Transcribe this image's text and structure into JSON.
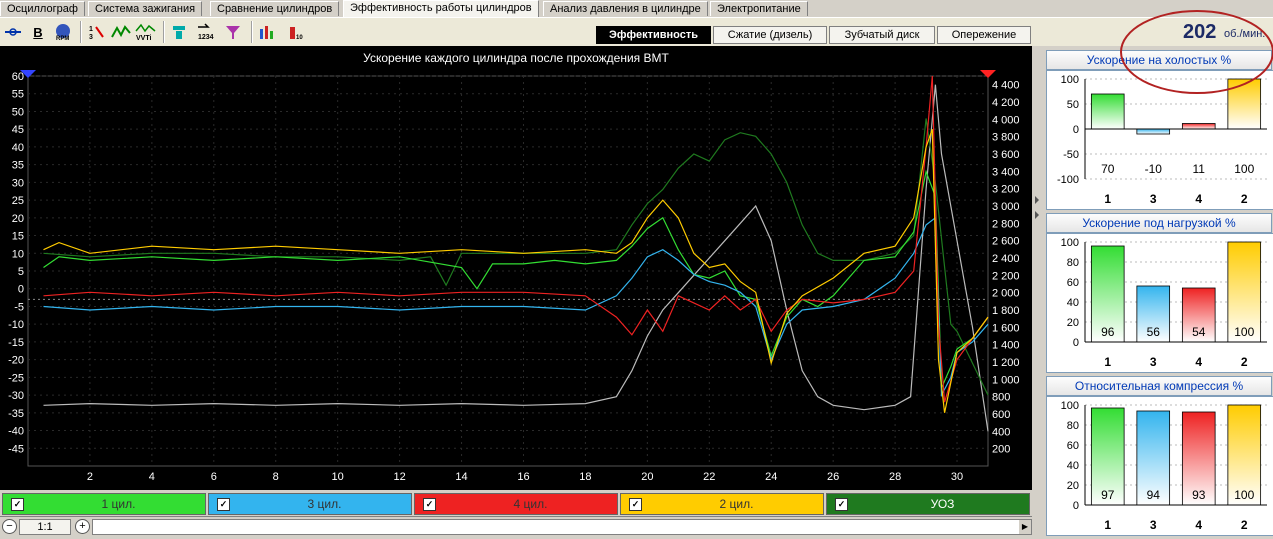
{
  "tabs": [
    "Осциллограф",
    "Система зажигания",
    "Сравнение цилиндров",
    "Эффективность работы цилиндров",
    "Анализ давления в цилиндре",
    "Электропитание"
  ],
  "active_tab": 3,
  "toolbar_icons": [
    "trigger-icon",
    "bold-icon",
    "rpm-icon",
    "tdc-icon",
    "wave-icon",
    "vvti-icon",
    "cylinder-icon",
    "sort-icon",
    "filter-icon",
    "bars-icon",
    "car-icon",
    "chart-icon"
  ],
  "mode_tabs": [
    "Эффективность",
    "Сжатие (дизель)",
    "Зубчатый диск",
    "Опережение"
  ],
  "active_mode": 0,
  "rpm": {
    "value": "202",
    "unit": "об./мин."
  },
  "colors": {
    "cyl1": "#33dd33",
    "cyl3": "#33b4ee",
    "cyl4": "#ee2222",
    "cyl2": "#ffcc00",
    "uoz": "#1f7a1f",
    "rpm_line": "#bbbbbb"
  },
  "chart_data": {
    "type": "line",
    "title": "Ускорение каждого цилиндра после прохождения ВМТ",
    "x_ticks": [
      "2",
      "4",
      "6",
      "8",
      "10",
      "12",
      "14",
      "16",
      "18",
      "20",
      "22",
      "24",
      "26",
      "28",
      "30"
    ],
    "xlim": [
      0,
      31
    ],
    "ylim_left": [
      -50,
      60
    ],
    "y_left_ticks": [
      "60",
      "55",
      "50",
      "45",
      "40",
      "35",
      "30",
      "25",
      "20",
      "15",
      "10",
      "5",
      "0",
      "-5",
      "-10",
      "-15",
      "-20",
      "-25",
      "-30",
      "-35",
      "-40",
      "-45"
    ],
    "ylim_right": [
      0,
      4500
    ],
    "y_right_ticks": [
      "4 400",
      "4 200",
      "4 000",
      "3 800",
      "3 600",
      "3 400",
      "3 200",
      "3 000",
      "2 800",
      "2 600",
      "2 400",
      "2 200",
      "2 000",
      "1 800",
      "1 600",
      "1 400",
      "1 200",
      "1 000",
      "800",
      "600",
      "400",
      "200"
    ],
    "series": [
      {
        "name": "1 цил.",
        "axis": "left",
        "points": [
          [
            0.5,
            6
          ],
          [
            1,
            9
          ],
          [
            2,
            8
          ],
          [
            4,
            9
          ],
          [
            6,
            8
          ],
          [
            8,
            9
          ],
          [
            10,
            8
          ],
          [
            12,
            9
          ],
          [
            14,
            6
          ],
          [
            14.5,
            0
          ],
          [
            15,
            7
          ],
          [
            16,
            7
          ],
          [
            17,
            8
          ],
          [
            18,
            7
          ],
          [
            19,
            8
          ],
          [
            19.5,
            12
          ],
          [
            20,
            17
          ],
          [
            20.5,
            20
          ],
          [
            21,
            11
          ],
          [
            21.5,
            4
          ],
          [
            22,
            3
          ],
          [
            22.5,
            5
          ],
          [
            23,
            -2
          ],
          [
            23.5,
            -3
          ],
          [
            24,
            -19
          ],
          [
            24.5,
            -8
          ],
          [
            25,
            -3
          ],
          [
            25.5,
            -5
          ],
          [
            26,
            -2
          ],
          [
            27,
            8
          ],
          [
            28,
            9
          ],
          [
            28.6,
            16
          ],
          [
            29,
            33
          ],
          [
            29.3,
            26
          ],
          [
            29.5,
            -28
          ],
          [
            29.8,
            -22
          ],
          [
            30,
            -17
          ],
          [
            30.5,
            -14
          ],
          [
            31,
            -8
          ]
        ]
      },
      {
        "name": "3 цил.",
        "axis": "left",
        "points": [
          [
            0.5,
            -5
          ],
          [
            2,
            -6
          ],
          [
            4,
            -5
          ],
          [
            6,
            -6
          ],
          [
            8,
            -5
          ],
          [
            10,
            -5
          ],
          [
            12,
            -6
          ],
          [
            14,
            -5
          ],
          [
            16,
            -5
          ],
          [
            18,
            -6
          ],
          [
            19,
            -2
          ],
          [
            19.5,
            3
          ],
          [
            20,
            9
          ],
          [
            20.5,
            11
          ],
          [
            21,
            8
          ],
          [
            21.5,
            4
          ],
          [
            22,
            2
          ],
          [
            22.5,
            1
          ],
          [
            23,
            -1
          ],
          [
            23.5,
            -5
          ],
          [
            24,
            -20
          ],
          [
            24.5,
            -10
          ],
          [
            25,
            -6
          ],
          [
            26,
            -5
          ],
          [
            27,
            -3
          ],
          [
            28,
            3
          ],
          [
            28.6,
            10
          ],
          [
            29,
            18
          ],
          [
            29.3,
            20
          ],
          [
            29.5,
            -30
          ],
          [
            29.8,
            -25
          ],
          [
            30,
            -18
          ],
          [
            30.5,
            -15
          ],
          [
            31,
            -10
          ]
        ]
      },
      {
        "name": "4 цил.",
        "axis": "left",
        "points": [
          [
            0.5,
            -2
          ],
          [
            2,
            -1
          ],
          [
            4,
            -2
          ],
          [
            6,
            -1
          ],
          [
            8,
            -2
          ],
          [
            10,
            -1
          ],
          [
            12,
            -2
          ],
          [
            14,
            -1
          ],
          [
            16,
            -1
          ],
          [
            18,
            -2
          ],
          [
            19,
            -8
          ],
          [
            19.5,
            -13
          ],
          [
            20,
            -6
          ],
          [
            20.5,
            -12
          ],
          [
            21,
            -2
          ],
          [
            21.5,
            -4
          ],
          [
            22,
            -6
          ],
          [
            22.5,
            -2
          ],
          [
            23,
            -6
          ],
          [
            23.5,
            -3
          ],
          [
            24,
            -12
          ],
          [
            24.5,
            -6
          ],
          [
            25,
            -3
          ],
          [
            26,
            -4
          ],
          [
            27,
            -3
          ],
          [
            28,
            -1
          ],
          [
            28.6,
            5
          ],
          [
            29,
            40
          ],
          [
            29.2,
            60
          ],
          [
            29.4,
            -10
          ],
          [
            29.6,
            -32
          ],
          [
            30,
            -20
          ],
          [
            30.5,
            -14
          ],
          [
            31,
            -8
          ]
        ]
      },
      {
        "name": "2 цил.",
        "axis": "left",
        "points": [
          [
            0.5,
            11
          ],
          [
            1,
            13
          ],
          [
            2,
            10
          ],
          [
            4,
            12
          ],
          [
            6,
            11
          ],
          [
            8,
            12
          ],
          [
            10,
            11
          ],
          [
            12,
            10
          ],
          [
            14,
            11
          ],
          [
            16,
            10
          ],
          [
            18,
            11
          ],
          [
            19,
            10
          ],
          [
            19.5,
            13
          ],
          [
            20,
            20
          ],
          [
            20.5,
            25
          ],
          [
            21,
            20
          ],
          [
            21.5,
            10
          ],
          [
            22,
            6
          ],
          [
            22.5,
            7
          ],
          [
            23,
            2
          ],
          [
            23.5,
            -1
          ],
          [
            24,
            -21
          ],
          [
            24.5,
            -7
          ],
          [
            25,
            -2
          ],
          [
            26,
            3
          ],
          [
            27,
            10
          ],
          [
            28,
            12
          ],
          [
            28.6,
            20
          ],
          [
            29,
            40
          ],
          [
            29.2,
            45
          ],
          [
            29.4,
            -20
          ],
          [
            29.6,
            -35
          ],
          [
            30,
            -18
          ],
          [
            30.5,
            -14
          ],
          [
            31,
            -8
          ]
        ]
      },
      {
        "name": "УОЗ",
        "axis": "left",
        "points": [
          [
            0.5,
            10
          ],
          [
            2,
            9
          ],
          [
            4,
            10
          ],
          [
            6,
            10
          ],
          [
            8,
            9
          ],
          [
            10,
            9
          ],
          [
            12,
            8
          ],
          [
            13,
            9
          ],
          [
            13.5,
            1
          ],
          [
            14,
            10
          ],
          [
            15,
            10
          ],
          [
            16,
            10
          ],
          [
            17,
            10
          ],
          [
            18,
            10
          ],
          [
            19,
            11
          ],
          [
            19.5,
            18
          ],
          [
            20,
            24
          ],
          [
            20.5,
            28
          ],
          [
            21,
            34
          ],
          [
            21.5,
            38
          ],
          [
            22,
            36
          ],
          [
            22.5,
            42
          ],
          [
            23,
            44
          ],
          [
            23.5,
            43
          ],
          [
            24,
            38
          ],
          [
            24.5,
            30
          ],
          [
            25,
            18
          ],
          [
            25.5,
            10
          ],
          [
            26,
            8
          ],
          [
            27,
            8
          ],
          [
            28,
            10
          ],
          [
            28.6,
            15
          ],
          [
            29,
            48
          ],
          [
            29.3,
            30
          ],
          [
            29.8,
            -10
          ],
          [
            30,
            -12
          ],
          [
            31,
            -30
          ]
        ]
      },
      {
        "name": "RPM",
        "axis": "right",
        "points": [
          [
            0.5,
            700
          ],
          [
            2,
            720
          ],
          [
            4,
            700
          ],
          [
            6,
            720
          ],
          [
            8,
            700
          ],
          [
            10,
            720
          ],
          [
            12,
            700
          ],
          [
            14,
            720
          ],
          [
            16,
            700
          ],
          [
            18,
            720
          ],
          [
            19,
            800
          ],
          [
            19.5,
            1100
          ],
          [
            20,
            1500
          ],
          [
            20.5,
            1800
          ],
          [
            21,
            2000
          ],
          [
            21.5,
            2200
          ],
          [
            22,
            2400
          ],
          [
            22.5,
            2600
          ],
          [
            23,
            2800
          ],
          [
            23.5,
            3000
          ],
          [
            24,
            2600
          ],
          [
            24.5,
            1800
          ],
          [
            25,
            1100
          ],
          [
            25.5,
            800
          ],
          [
            26,
            700
          ],
          [
            27,
            650
          ],
          [
            28,
            700
          ],
          [
            28.5,
            800
          ],
          [
            29,
            3200
          ],
          [
            29.3,
            4400
          ],
          [
            29.5,
            3600
          ],
          [
            30,
            2600
          ],
          [
            30.5,
            1600
          ],
          [
            31,
            400
          ]
        ]
      }
    ]
  },
  "legend": [
    {
      "label": "1 цил.",
      "color": "#33dd33",
      "check": "✓"
    },
    {
      "label": "3 цил.",
      "color": "#33b4ee",
      "check": "✓"
    },
    {
      "label": "4 цил.",
      "color": "#ee2222",
      "check": "✓"
    },
    {
      "label": "2 цил.",
      "color": "#ffcc00",
      "check": "✓"
    },
    {
      "label": "УОЗ",
      "color": "#1f7a1f",
      "check": "✓"
    }
  ],
  "zoom_label": "1:1",
  "panels": [
    {
      "title": "Ускорение на холостых %",
      "ylim": [
        -100,
        100
      ],
      "yticks": [
        "100",
        "50",
        "0",
        "-50",
        "-100"
      ],
      "cats": [
        "1",
        "3",
        "4",
        "2"
      ],
      "values": [
        70,
        -10,
        11,
        100
      ],
      "labels": [
        "70",
        "-10",
        "11",
        "100"
      ]
    },
    {
      "title": "Ускорение под нагрузкой %",
      "ylim": [
        0,
        100
      ],
      "yticks": [
        "100",
        "80",
        "60",
        "40",
        "20",
        "0"
      ],
      "cats": [
        "1",
        "3",
        "4",
        "2"
      ],
      "values": [
        96,
        56,
        54,
        100
      ],
      "labels": [
        "96",
        "56",
        "54",
        "100"
      ]
    },
    {
      "title": "Относительная компрессия %",
      "ylim": [
        0,
        100
      ],
      "yticks": [
        "100",
        "80",
        "60",
        "40",
        "20",
        "0"
      ],
      "cats": [
        "1",
        "3",
        "4",
        "2"
      ],
      "values": [
        97,
        94,
        93,
        100
      ],
      "labels": [
        "97",
        "94",
        "93",
        "100"
      ]
    }
  ]
}
